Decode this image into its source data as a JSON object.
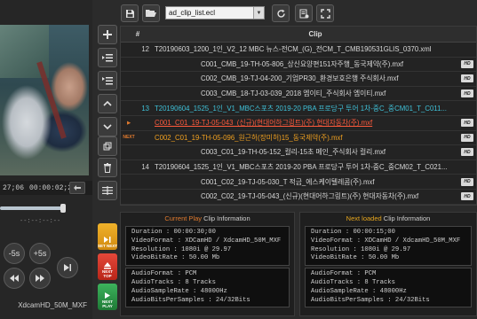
{
  "player": {
    "timecode_current": "27;06",
    "timecode_total": "00:00:02;23",
    "small_timecode": "--:--:--:--",
    "progress_fraction": 1.0,
    "skip_back_label": "-5s",
    "skip_fwd_label": "+5s",
    "status_text": "XdcamHD_50M_MXF"
  },
  "toolbar": {
    "playlist_value": "ad_clip_list.ecl"
  },
  "side_buttons": {
    "set_next": "SET NEXT",
    "next_top": "NEXT TOP",
    "next_play": "NEXT PLAY"
  },
  "table": {
    "header_num": "#",
    "header_clip": "Clip",
    "rows": [
      {
        "mark": "",
        "num": "12",
        "clip": "T20190603_1200_1인_V2_12 MBC 뉴스-전CM_(G)_전CM_T_CMB190531GLIS_0370.xml",
        "type": "parent",
        "hd": false
      },
      {
        "mark": "",
        "num": "",
        "clip": "C001_CMB_19-TH-05-806_상신요양편151자주행_동국제약(주).mxf",
        "type": "sub",
        "hd": true
      },
      {
        "mark": "",
        "num": "",
        "clip": "C002_CMB_19-TJ-04-200_기업PR30_환경보호은행 주식회사.mxf",
        "type": "sub",
        "hd": true
      },
      {
        "mark": "",
        "num": "",
        "clip": "C003_CMB_18-TJ-03-039_2018 엠이티_주식회사 엠이티.mxf",
        "type": "sub",
        "hd": true
      },
      {
        "mark": "",
        "num": "13",
        "clip": "T20190604_1525_1인_V1_MBC스포츠 2019-20 PBA 프로당구 투어 1차-중C_중CM01_T_C011...",
        "type": "parent-cyan",
        "hd": false
      },
      {
        "mark": "▶",
        "num": "",
        "clip": "C001_C01_19-TJ-05-043_(신규)(현대어하그링트)(주) 현대자동차(주).mxf",
        "type": "playing",
        "hd": true
      },
      {
        "mark": "NEXT",
        "num": "",
        "clip": "C002_C01_19-TH-05-096_원근허(장미허)15_동국제약(주).mxf",
        "type": "next",
        "hd": true
      },
      {
        "mark": "",
        "num": "",
        "clip": "C003_C01_19-TH-05-152_컬리-15초 메인_주식회사 컬리.mxf",
        "type": "sub",
        "hd": true
      },
      {
        "mark": "",
        "num": "14",
        "clip": "T20190604_1525_1인_V1_MBC스포츠 2019-20 PBA 프로당구 투어 1차-중C_중CM02_T_C021...",
        "type": "parent",
        "hd": false
      },
      {
        "mark": "",
        "num": "",
        "clip": "C001_C02_19-TJ-05-030_T 적금_에스케이텔레콤(주).mxf",
        "type": "sub",
        "hd": true
      },
      {
        "mark": "",
        "num": "",
        "clip": "C002_C02_19-TJ-05-043_(신규)(현대어하그링트)(주) 현대자동차(주).mxf",
        "type": "sub",
        "hd": true
      }
    ],
    "hd_badge": "HD"
  },
  "info_current": {
    "title_colored": "Current Play",
    "title_rest": " Clip Information",
    "title_color": "#e07a2e",
    "video": [
      "Duration      : 00:00:30;00",
      "VideoFormat   : XDCamHD / XdcamHD_50M_MXF",
      "Resolution    : 1080i @ 29.97",
      "VideoBitRate  : 50.00 Mb"
    ],
    "audio": [
      "AudioFormat      : PCM",
      "AudioTracks      : 8 Tracks",
      "AudioSampleRate  : 48000Hz",
      "AudioBitsPerSamples : 24/32Bits"
    ]
  },
  "info_next": {
    "title_colored": "Next loaded",
    "title_rest": " Clip Information",
    "title_color": "#e6a61e",
    "video": [
      "Duration      : 00:00:15;00",
      "VideoFormat   : XDCamHD / XdcamHD_50M_MXF",
      "Resolution    : 1080i @ 29.97",
      "VideoBitRate  : 50.00 Mb"
    ],
    "audio": [
      "AudioFormat      : PCM",
      "AudioTracks      : 8 Tracks",
      "AudioSampleRate  : 48000Hz",
      "AudioBitsPerSamples : 24/32Bits"
    ]
  },
  "colors": {
    "set_next_btn": "#e8a21a",
    "next_top_btn": "#d9372a",
    "next_play_btn": "#2e9a4a",
    "playing_text": "#ff5a3c",
    "next_text": "#f0a020",
    "cyan_text": "#3fc1d8"
  },
  "icons": {
    "save": "floppy-disk-icon",
    "open": "folder-open-icon",
    "refresh": "refresh-icon",
    "list": "list-settings-icon",
    "fullscreen": "fullscreen-icon",
    "add": "plus-icon",
    "up": "chevron-up-icon",
    "down": "chevron-down-icon",
    "delete": "trash-icon"
  }
}
